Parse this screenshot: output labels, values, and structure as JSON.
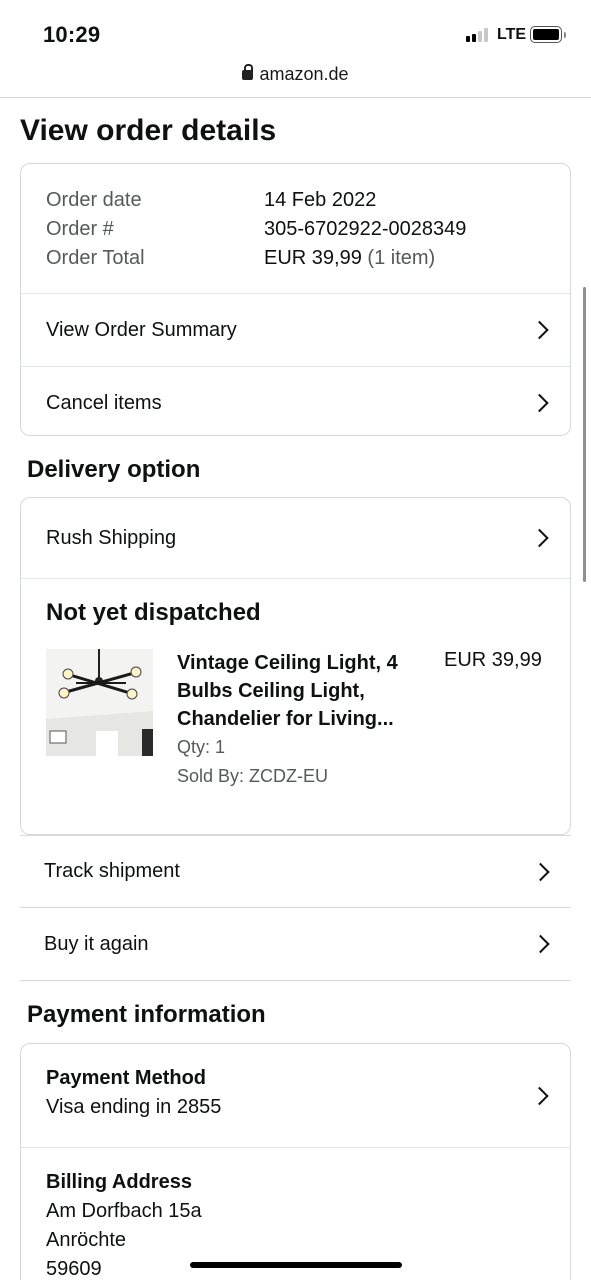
{
  "status_bar": {
    "time": "10:29",
    "network": "LTE"
  },
  "browser": {
    "domain": "amazon.de"
  },
  "page": {
    "title": "View order details"
  },
  "order": {
    "date_label": "Order date",
    "date_value": "14 Feb 2022",
    "number_label": "Order #",
    "number_value": "305-6702922-0028349",
    "total_label": "Order Total",
    "total_value": "EUR 39,99",
    "total_items": "(1 item)",
    "summary_link": "View Order Summary",
    "cancel_link": "Cancel items"
  },
  "delivery": {
    "heading": "Delivery option",
    "option": "Rush Shipping",
    "status": "Not yet dispatched",
    "item": {
      "name": "Vintage Ceiling Light, 4 Bulbs Ceiling Light, Chandelier for Living...",
      "price": "EUR 39,99",
      "qty": "Qty: 1",
      "seller": "Sold By: ZCDZ-EU"
    },
    "track": "Track shipment",
    "buy_again": "Buy it again"
  },
  "payment": {
    "heading": "Payment information",
    "method_label": "Payment Method",
    "method_value": "Visa ending in 2855",
    "billing_label": "Billing Address",
    "address_line1": "Am Dorfbach 15a",
    "address_line2": "Anröchte",
    "address_line3": "59609"
  },
  "icons": {
    "lock": "lock-icon",
    "chevron": "chevron-right-icon",
    "signal": "cellular-signal-icon",
    "battery": "battery-icon"
  }
}
